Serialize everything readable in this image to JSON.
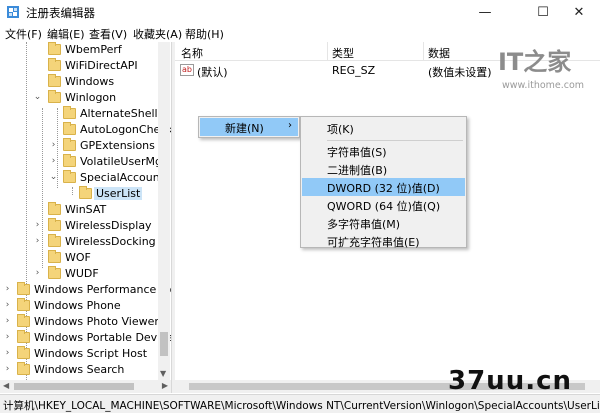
{
  "window": {
    "title": "注册表编辑器",
    "minimize_glyph": "—",
    "maximize_glyph": "☐",
    "close_glyph": "✕"
  },
  "menu": [
    "文件(F)",
    "编辑(E)",
    "查看(V)",
    "收藏夹(A)",
    "帮助(H)"
  ],
  "tree": [
    {
      "label": "WbemPerf",
      "twisty": ""
    },
    {
      "label": "WiFiDirectAPI",
      "twisty": ""
    },
    {
      "label": "Windows",
      "twisty": ""
    },
    {
      "label": "Winlogon",
      "twisty": "expanded"
    },
    {
      "label": "AlternateShells",
      "twisty": ""
    },
    {
      "label": "AutoLogonCheck",
      "twisty": ""
    },
    {
      "label": "GPExtensions",
      "twisty": "collapsed"
    },
    {
      "label": "VolatileUserMgrI",
      "twisty": "collapsed"
    },
    {
      "label": "SpecialAccounts",
      "twisty": "expanded"
    },
    {
      "label": "UserList",
      "twisty": ""
    },
    {
      "label": "WinSAT",
      "twisty": ""
    },
    {
      "label": "WirelessDisplay",
      "twisty": "collapsed"
    },
    {
      "label": "WirelessDocking",
      "twisty": "collapsed"
    },
    {
      "label": "WOF",
      "twisty": ""
    },
    {
      "label": "WUDF",
      "twisty": "collapsed"
    },
    {
      "label": "Windows Performance Toc",
      "twisty": "collapsed"
    },
    {
      "label": "Windows Phone",
      "twisty": "collapsed"
    },
    {
      "label": "Windows Photo Viewer",
      "twisty": "collapsed"
    },
    {
      "label": "Windows Portable Devices",
      "twisty": "collapsed"
    },
    {
      "label": "Windows Script Host",
      "twisty": "collapsed"
    },
    {
      "label": "Windows Search",
      "twisty": "collapsed"
    }
  ],
  "list": {
    "headers": {
      "name": "名称",
      "type": "类型",
      "data": "数据"
    },
    "rows": [
      {
        "name": "(默认)",
        "type": "REG_SZ",
        "data": "(数值未设置)",
        "icon": "ab"
      }
    ]
  },
  "context_menu": {
    "new_label": "新建(N)",
    "new_arrow": "›",
    "submenu": {
      "key": "项(K)",
      "string": "字符串值(S)",
      "binary": "二进制值(B)",
      "dword": "DWORD (32 位)值(D)",
      "qword": "QWORD (64 位)值(Q)",
      "multi_string": "多字符串值(M)",
      "expand_string": "可扩充字符串值(E)"
    }
  },
  "status": {
    "path": "计算机\\HKEY_LOCAL_MACHINE\\SOFTWARE\\Microsoft\\Windows NT\\CurrentVersion\\Winlogon\\SpecialAccounts\\UserList"
  },
  "watermarks": {
    "logo_text": "IT之家",
    "url": "www.ithome.com",
    "site": "37uu.cn"
  },
  "colors": {
    "highlight": "#91c9f7",
    "selected_tree": "#cce4f7",
    "folder": "#f4d47a",
    "menu_bg": "#f0f0f0"
  }
}
